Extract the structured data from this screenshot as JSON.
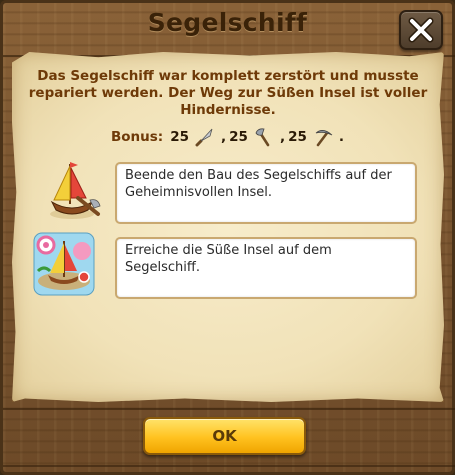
{
  "dialog": {
    "title": "Segelschiff",
    "description": "Das Segelschiff war komplett zerstört und musste repariert werden. Der Weg zur Süßen Insel ist voller Hindernisse.",
    "close_icon": "close-x-icon"
  },
  "bonus": {
    "label": "Bonus:",
    "items": [
      {
        "amount": "25",
        "icon": "knife-icon",
        "after": ","
      },
      {
        "amount": "25",
        "icon": "axe-icon",
        "after": ","
      },
      {
        "amount": "25",
        "icon": "pickaxe-icon",
        "after": "."
      }
    ]
  },
  "quests": [
    {
      "icon": "sailing-ship-construction-icon",
      "text": "Beende den Bau des Segelschiffs auf der Geheimnisvollen Insel."
    },
    {
      "icon": "sweet-island-ship-icon",
      "text": "Erreiche die Süße Insel auf dem Segelschiff."
    }
  ],
  "buttons": {
    "ok_label": "OK"
  },
  "colors": {
    "wood": "#7a5530",
    "parchment": "#f1e2b8",
    "description_text": "#6e3a08",
    "ok_button": "#ffc21f"
  }
}
